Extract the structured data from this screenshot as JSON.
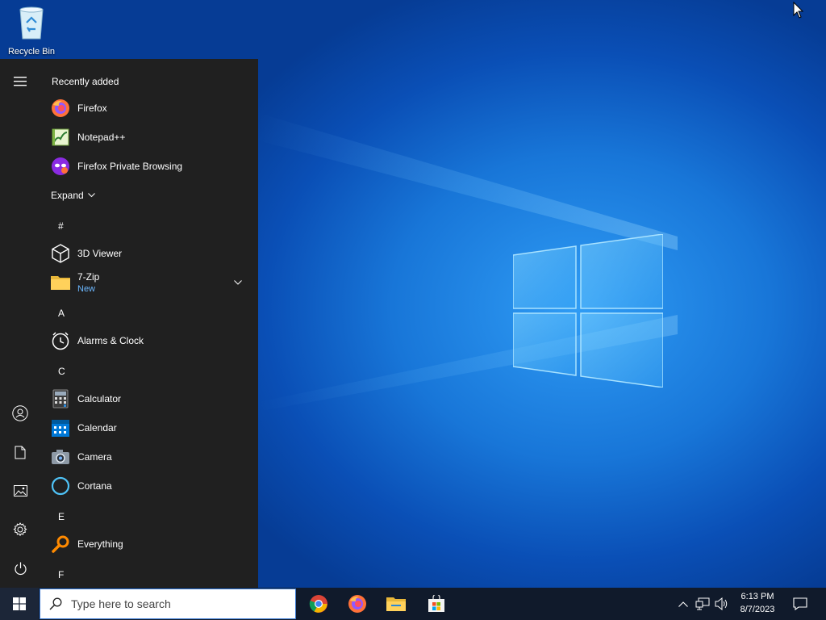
{
  "desktop": {
    "icons": [
      {
        "label": "Recycle Bin",
        "icon": "recycle-bin-icon"
      }
    ]
  },
  "start_menu": {
    "recently_added_header": "Recently added",
    "recent": [
      {
        "label": "Firefox",
        "icon": "firefox-icon"
      },
      {
        "label": "Notepad++",
        "icon": "notepadpp-icon"
      },
      {
        "label": "Firefox Private Browsing",
        "icon": "firefox-private-icon"
      }
    ],
    "expand_label": "Expand",
    "groups": {
      "hash": "#",
      "a": "A",
      "c": "C",
      "e": "E",
      "f": "F"
    },
    "apps": {
      "viewer3d": "3D Viewer",
      "zip": "7-Zip",
      "zip_badge": "New",
      "alarms": "Alarms & Clock",
      "calculator": "Calculator",
      "calendar": "Calendar",
      "camera": "Camera",
      "cortana": "Cortana",
      "everything": "Everything"
    },
    "rail": [
      "menu-icon",
      "user-icon",
      "documents-icon",
      "pictures-icon",
      "settings-icon",
      "power-icon"
    ]
  },
  "taskbar": {
    "search_placeholder": "Type here to search",
    "pinned": [
      "chrome-icon",
      "firefox-icon",
      "file-explorer-icon",
      "store-icon"
    ],
    "time": "6:13 PM",
    "date": "8/7/2023"
  },
  "colors": {
    "start_bg": "#202020",
    "taskbar_bg": "#101a2b",
    "accent": "#0078d7",
    "new_badge": "#6cb8ff"
  }
}
